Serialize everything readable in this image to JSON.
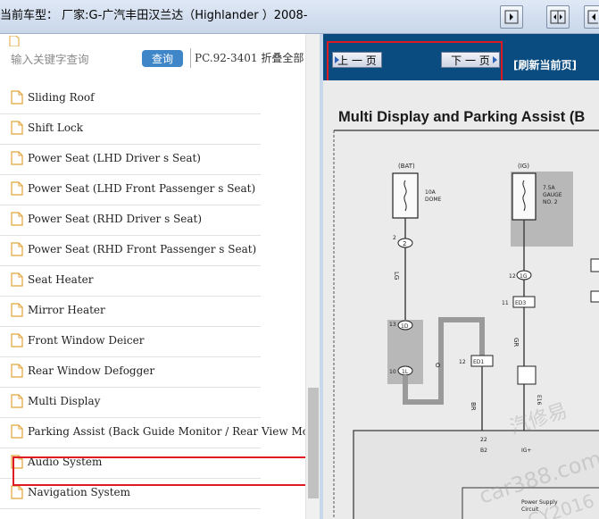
{
  "header": {
    "title": "当前车型：  厂家:G-广汽丰田汉兰达（Highlander ）2008-",
    "buttons": [
      {
        "name": "expand-panel-button"
      },
      {
        "name": "split-view-button"
      },
      {
        "name": "collapse-panel-button"
      }
    ]
  },
  "search": {
    "placeholder": "输入关键字查询",
    "button_label": "查询",
    "model_info": "PC.92-3401 折叠全部"
  },
  "tree": {
    "items": [
      {
        "label": "Sliding Roof"
      },
      {
        "label": "Shift Lock"
      },
      {
        "label": "Power Seat (LHD Driver s Seat)"
      },
      {
        "label": "Power Seat (LHD Front Passenger s Seat)"
      },
      {
        "label": "Power Seat (RHD Driver s Seat)"
      },
      {
        "label": "Power Seat (RHD Front Passenger s Seat)"
      },
      {
        "label": "Seat Heater"
      },
      {
        "label": "Mirror Heater"
      },
      {
        "label": "Front Window Deicer"
      },
      {
        "label": "Rear Window Defogger"
      },
      {
        "label": "Multi Display"
      },
      {
        "label": "Parking Assist (Back Guide Monitor / Rear View Monitor"
      },
      {
        "label": "Audio System"
      },
      {
        "label": "Navigation System"
      }
    ],
    "selected_index": 11
  },
  "viewer": {
    "prev_label": "上 一 页",
    "next_label": "下 一 页",
    "refresh_label": "[刷新当前页]",
    "diagram_title": "Multi Display and Parking Assist (B",
    "diagram": {
      "bat_label": "(BAT)",
      "ig_label": "(IG)",
      "fuse1": "10A\nDOME",
      "fuse2": "7.5A\nGAUGE\nNO. 2",
      "connectors": [
        "2",
        "ED3",
        "1D",
        "1L",
        "ED1",
        "1G",
        "E16"
      ],
      "wire_colors": [
        "LG",
        "GR",
        "O",
        "BR"
      ],
      "pins": [
        "2",
        "12",
        "11",
        "13",
        "10",
        "12",
        "22",
        "B2",
        "IG+",
        "1"
      ],
      "box_label": "Power Supply\nCircuit",
      "watermarks": [
        "汽修易",
        "car388.com",
        "CY2016"
      ]
    }
  },
  "colors": {
    "header_bg": "#c9d7ea",
    "toolbar_bg": "#0a4c80",
    "highlight": "#e01a22",
    "search_button": "#3f86c9"
  }
}
